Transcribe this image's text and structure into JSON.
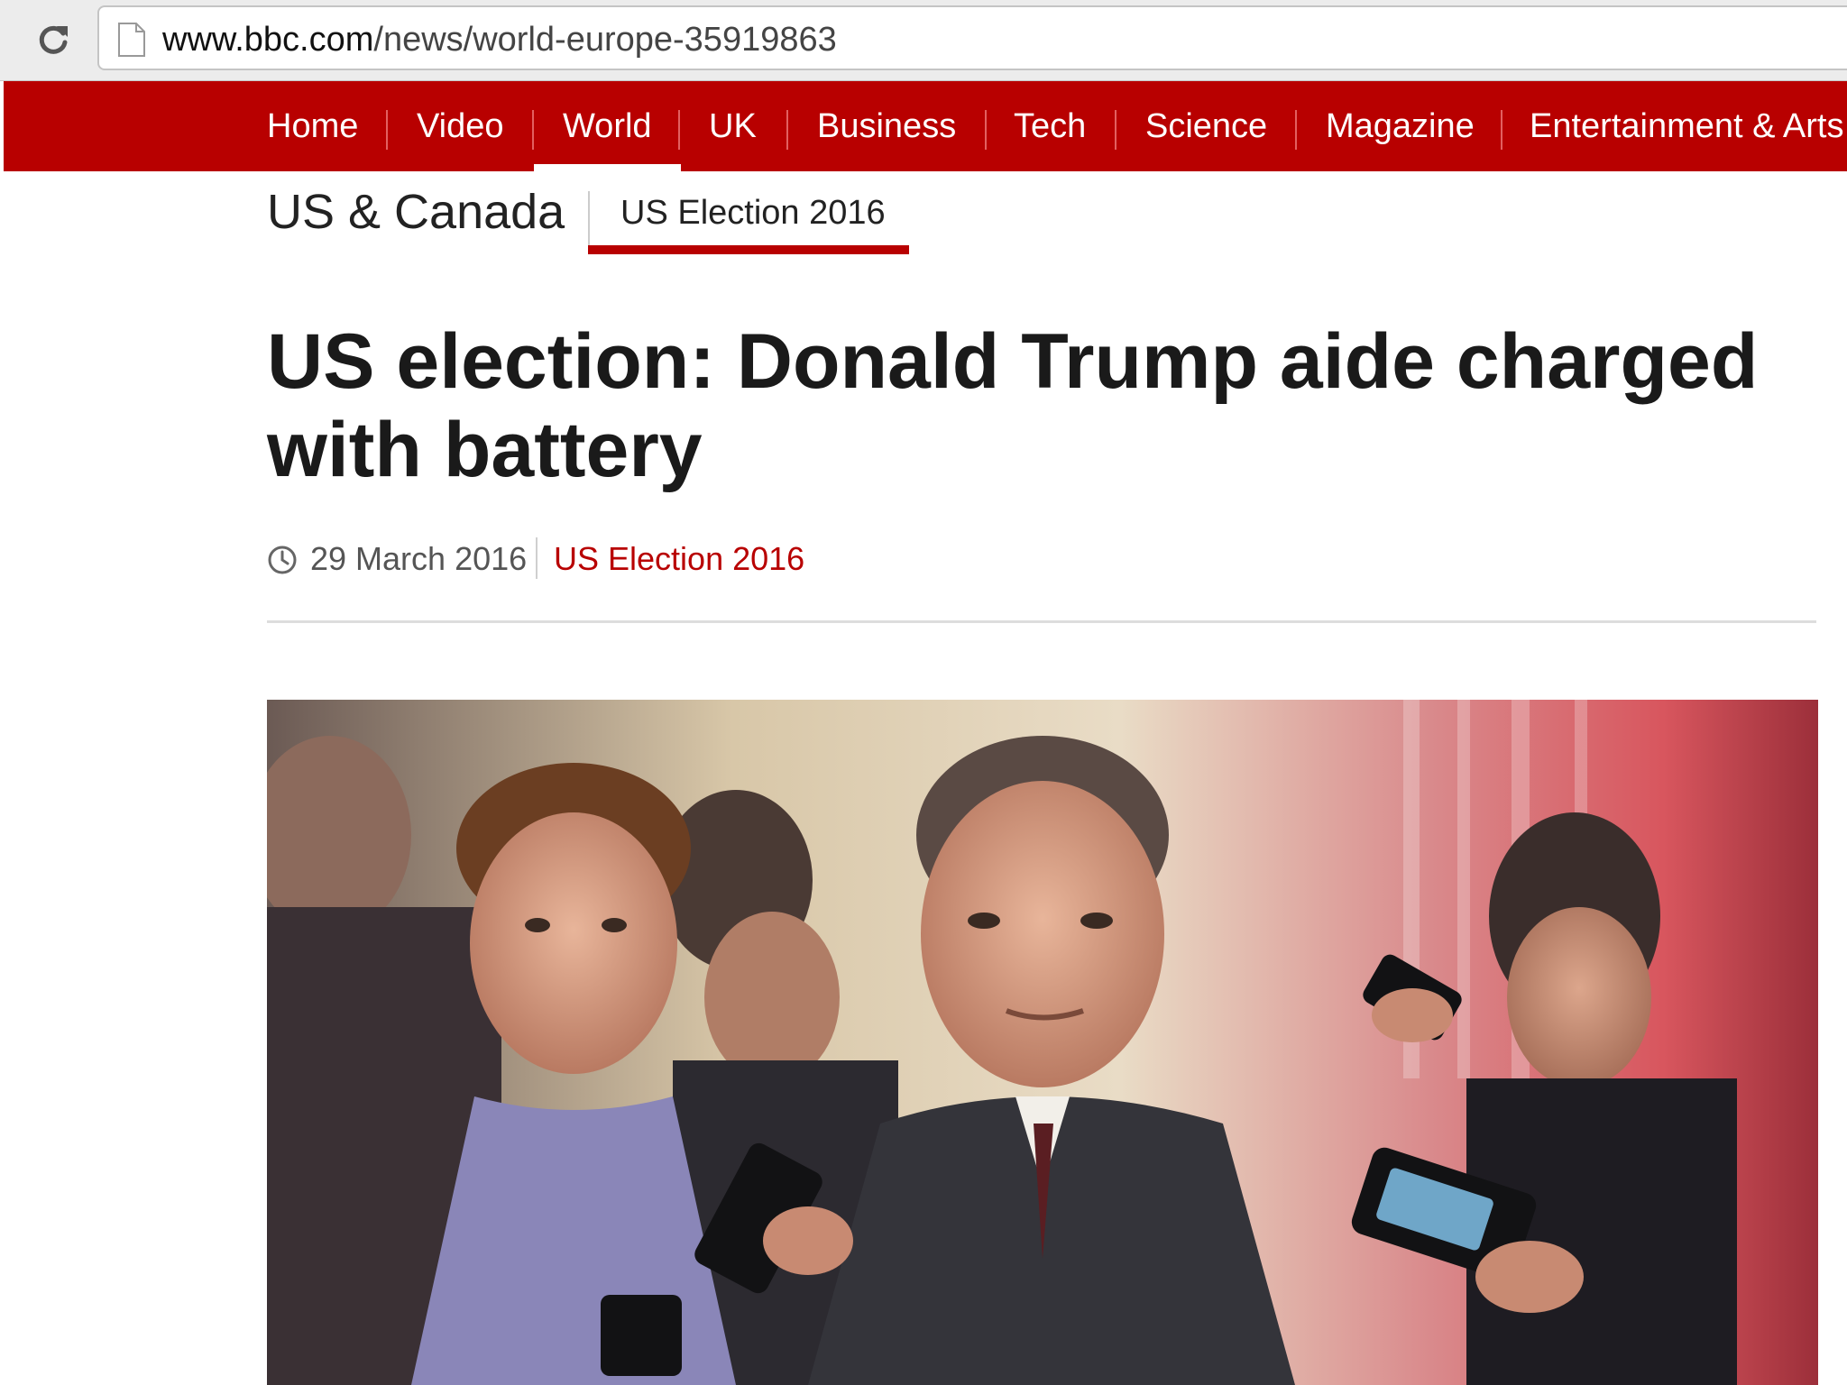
{
  "browser": {
    "url_host": "www.bbc.com",
    "url_path": "/news/world-europe-35919863"
  },
  "nav": {
    "items": [
      {
        "label": "Home"
      },
      {
        "label": "Video"
      },
      {
        "label": "World",
        "active": true
      },
      {
        "label": "UK"
      },
      {
        "label": "Business"
      },
      {
        "label": "Tech"
      },
      {
        "label": "Science"
      },
      {
        "label": "Magazine"
      },
      {
        "label": "Entertainment & Arts"
      }
    ]
  },
  "section": {
    "title": "US & Canada",
    "subnav_active": "US Election 2016"
  },
  "article": {
    "headline": "US election: Donald Trump aide charged with battery",
    "date": "29 March 2016",
    "topic_link": "US Election 2016"
  },
  "colors": {
    "brand_red": "#b80000",
    "text_dark": "#1a1a1a",
    "meta_gray": "#555555"
  },
  "icons": {
    "reload": "reload-icon",
    "page": "page-icon",
    "clock": "clock-icon"
  }
}
